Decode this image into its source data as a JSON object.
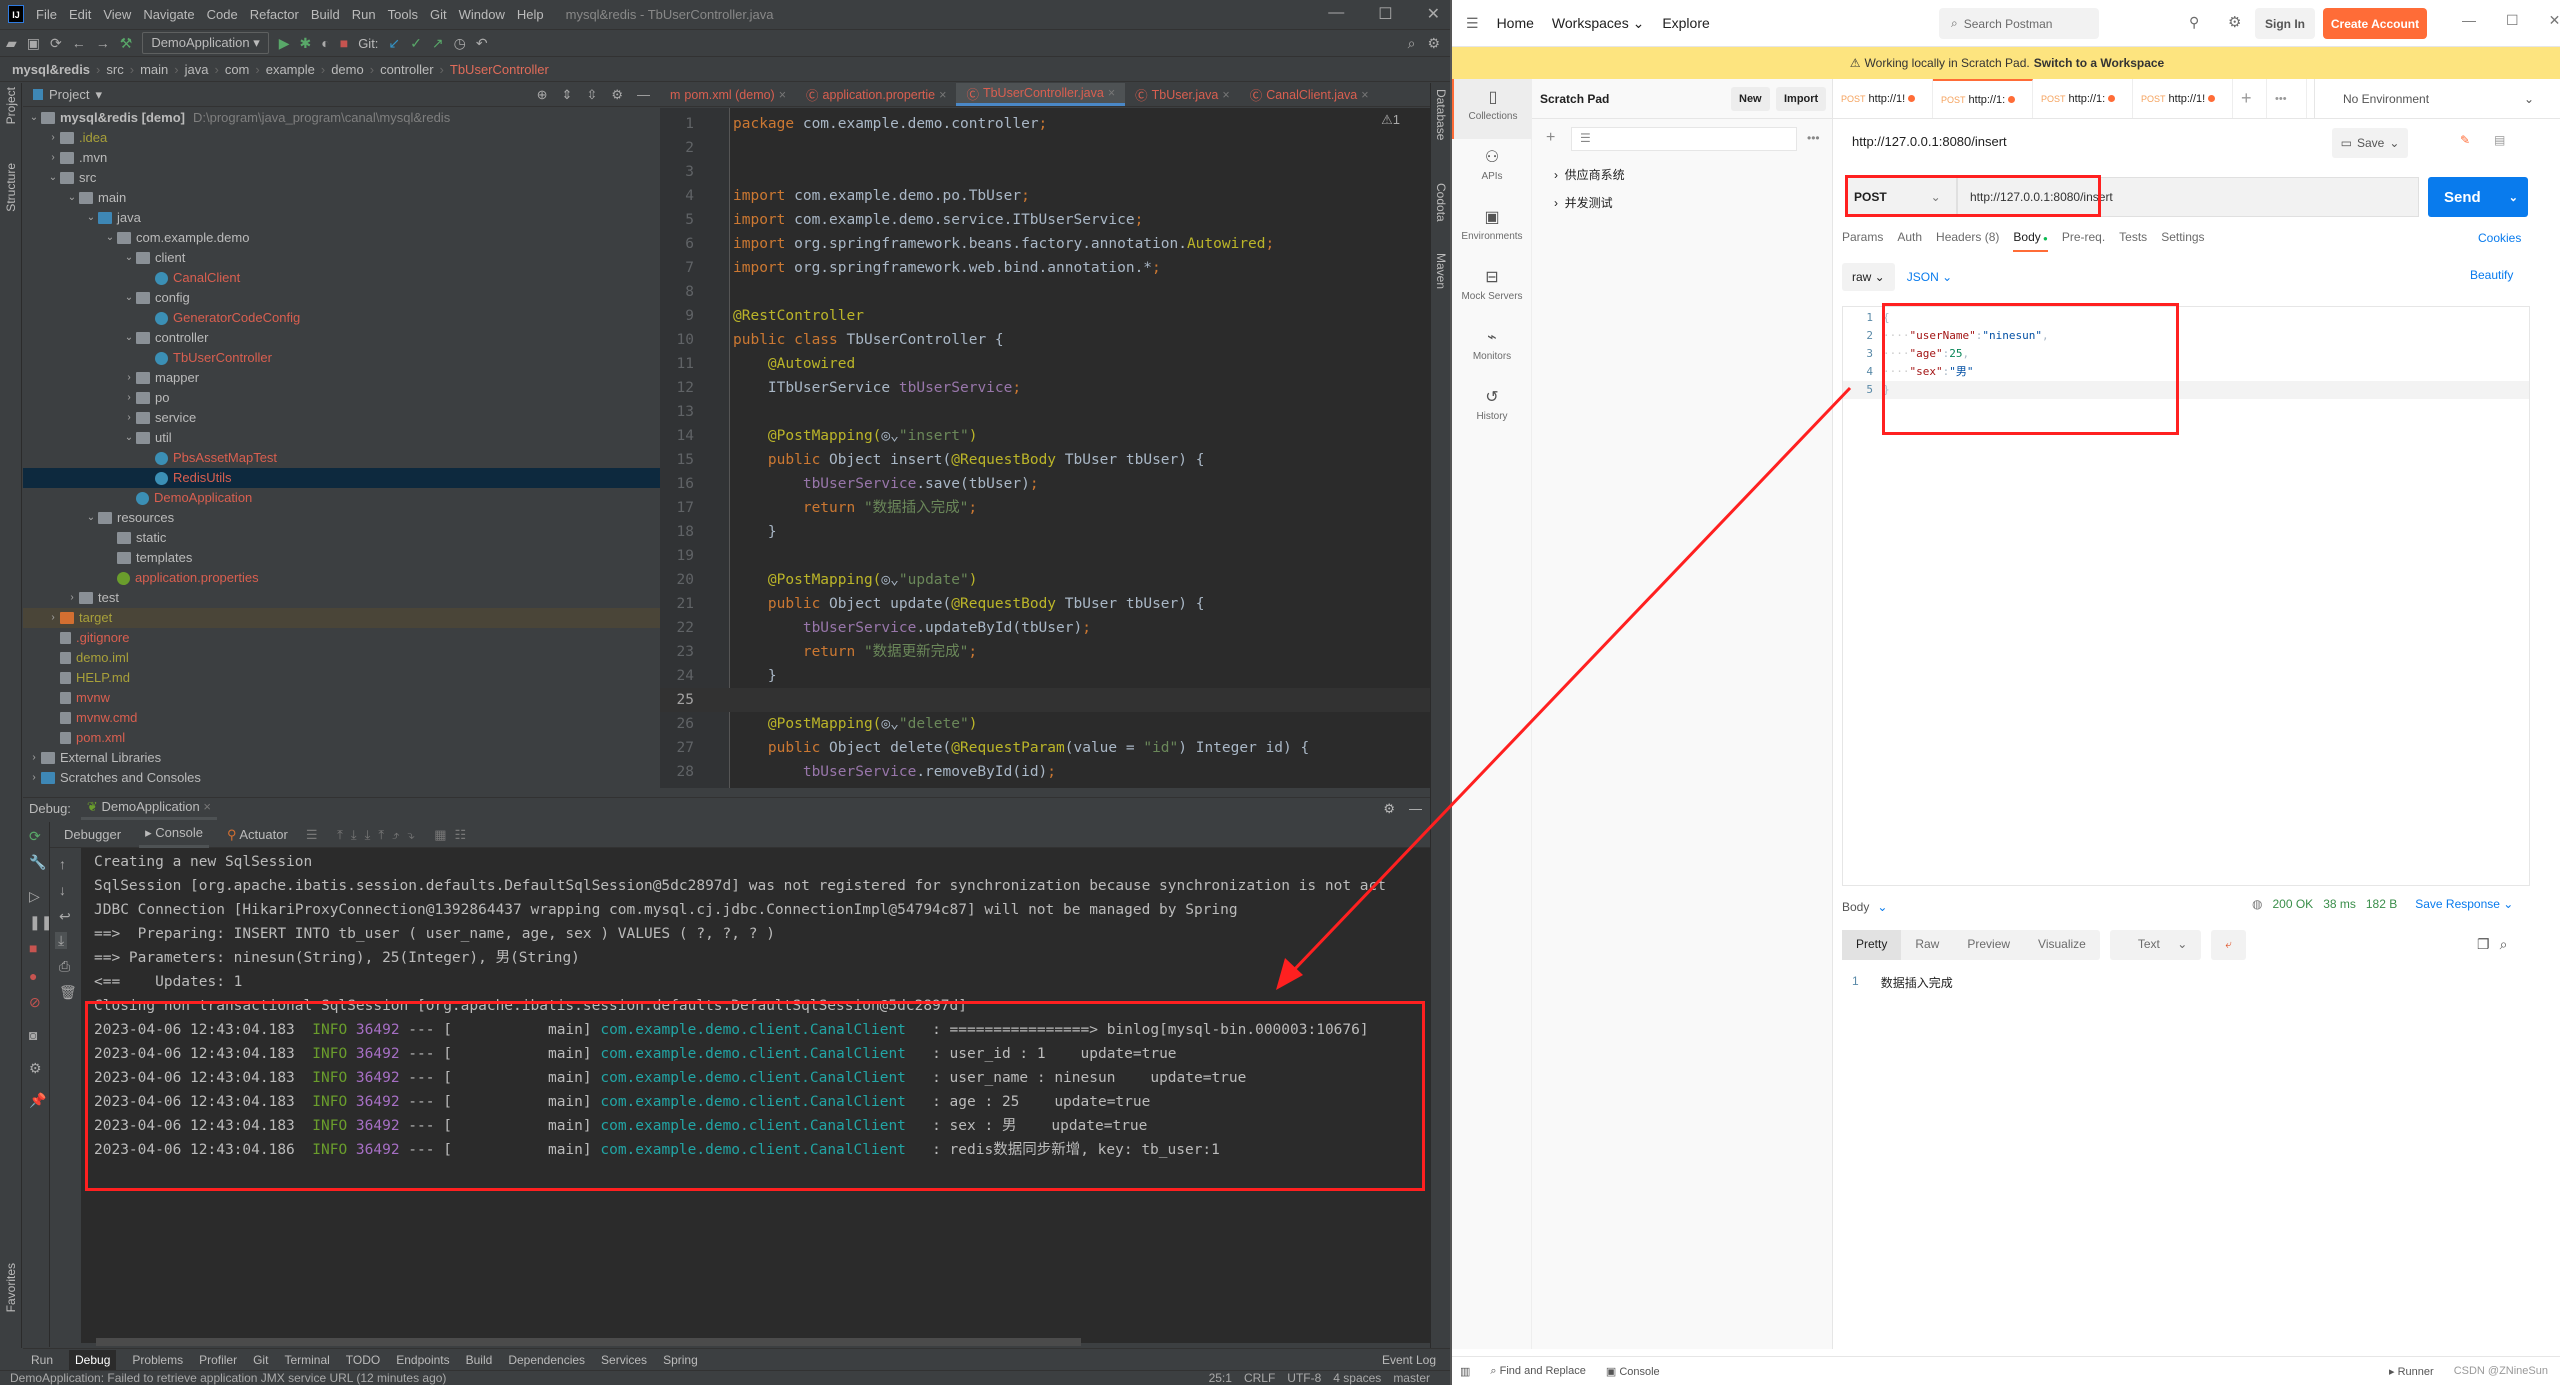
{
  "ide": {
    "logo": "IJ",
    "menu": [
      "File",
      "Edit",
      "View",
      "Navigate",
      "Code",
      "Refactor",
      "Build",
      "Run",
      "Tools",
      "Git",
      "Window",
      "Help"
    ],
    "window_title": "mysql&redis - TbUserController.java",
    "run_config": "DemoApplication",
    "git_label": "Git:",
    "breadcrumb": [
      "mysql&redis",
      "src",
      "main",
      "java",
      "com",
      "example",
      "demo",
      "controller",
      "TbUserController"
    ],
    "project_label": "Project",
    "left_strip": [
      "Project",
      "Structure",
      "Favorites"
    ],
    "right_strip": [
      "Database",
      "Codota",
      "Maven"
    ],
    "tree": [
      {
        "d": 0,
        "o": "v",
        "i": "module",
        "t": "mysql&redis [demo]",
        "c": "gray",
        "s": "D:\\program\\java_program\\canal\\mysql&redis"
      },
      {
        "d": 1,
        "o": ">",
        "i": "folder",
        "t": ".idea",
        "c": "olive"
      },
      {
        "d": 1,
        "o": ">",
        "i": "folder",
        "t": ".mvn",
        "c": "gray"
      },
      {
        "d": 1,
        "o": "v",
        "i": "folder",
        "t": "src",
        "c": "gray"
      },
      {
        "d": 2,
        "o": "v",
        "i": "folder",
        "t": "main",
        "c": "gray"
      },
      {
        "d": 3,
        "o": "v",
        "i": "src",
        "t": "java",
        "c": "gray"
      },
      {
        "d": 4,
        "o": "v",
        "i": "folder",
        "t": "com.example.demo",
        "c": "gray"
      },
      {
        "d": 5,
        "o": "v",
        "i": "folder",
        "t": "client",
        "c": "gray"
      },
      {
        "d": 6,
        "o": "",
        "i": "class",
        "t": "CanalClient",
        "c": "red"
      },
      {
        "d": 5,
        "o": "v",
        "i": "folder",
        "t": "config",
        "c": "gray"
      },
      {
        "d": 6,
        "o": "",
        "i": "class",
        "t": "GeneratorCodeConfig",
        "c": "red"
      },
      {
        "d": 5,
        "o": "v",
        "i": "folder",
        "t": "controller",
        "c": "gray"
      },
      {
        "d": 6,
        "o": "",
        "i": "class",
        "t": "TbUserController",
        "c": "red"
      },
      {
        "d": 5,
        "o": ">",
        "i": "folder",
        "t": "mapper",
        "c": "gray"
      },
      {
        "d": 5,
        "o": ">",
        "i": "folder",
        "t": "po",
        "c": "gray"
      },
      {
        "d": 5,
        "o": ">",
        "i": "folder",
        "t": "service",
        "c": "gray"
      },
      {
        "d": 5,
        "o": "v",
        "i": "folder",
        "t": "util",
        "c": "gray"
      },
      {
        "d": 6,
        "o": "",
        "i": "class",
        "t": "PbsAssetMapTest",
        "c": "red"
      },
      {
        "d": 6,
        "o": "",
        "i": "class",
        "t": "RedisUtils",
        "c": "red",
        "sel": true
      },
      {
        "d": 5,
        "o": "",
        "i": "class",
        "t": "DemoApplication",
        "c": "red"
      },
      {
        "d": 3,
        "o": "v",
        "i": "folder",
        "t": "resources",
        "c": "gray"
      },
      {
        "d": 4,
        "o": "",
        "i": "folder",
        "t": "static",
        "c": "gray"
      },
      {
        "d": 4,
        "o": "",
        "i": "folder",
        "t": "templates",
        "c": "gray"
      },
      {
        "d": 4,
        "o": "",
        "i": "spring",
        "t": "application.properties",
        "c": "red"
      },
      {
        "d": 2,
        "o": ">",
        "i": "folder",
        "t": "test",
        "c": "gray"
      },
      {
        "d": 1,
        "o": ">",
        "i": "orange",
        "t": "target",
        "c": "olive",
        "tgt": true
      },
      {
        "d": 1,
        "o": "",
        "i": "file",
        "t": ".gitignore",
        "c": "red"
      },
      {
        "d": 1,
        "o": "",
        "i": "file",
        "t": "demo.iml",
        "c": "olive"
      },
      {
        "d": 1,
        "o": "",
        "i": "file",
        "t": "HELP.md",
        "c": "olive"
      },
      {
        "d": 1,
        "o": "",
        "i": "file",
        "t": "mvnw",
        "c": "red"
      },
      {
        "d": 1,
        "o": "",
        "i": "file",
        "t": "mvnw.cmd",
        "c": "red"
      },
      {
        "d": 1,
        "o": "",
        "i": "file",
        "t": "pom.xml",
        "c": "red"
      },
      {
        "d": 0,
        "o": ">",
        "i": "lib",
        "t": "External Libraries",
        "c": "gray"
      },
      {
        "d": 0,
        "o": ">",
        "i": "scratch",
        "t": "Scratches and Consoles",
        "c": "gray"
      }
    ],
    "editor_tabs": [
      {
        "t": "pom.xml (demo)"
      },
      {
        "t": "application.propertie"
      },
      {
        "t": "TbUserController.java",
        "active": true
      },
      {
        "t": "TbUser.java"
      },
      {
        "t": "CanalClient.java"
      }
    ],
    "warning_count": "⚠1",
    "code": [
      [
        [
          "package ",
          "kw"
        ],
        [
          "com.example.demo.controller",
          "df"
        ],
        [
          ";",
          "kw"
        ]
      ],
      [],
      [],
      [
        [
          "import ",
          "kw"
        ],
        [
          "com.example.demo.po.TbUser",
          "df"
        ],
        [
          ";",
          "kw"
        ]
      ],
      [
        [
          "import ",
          "kw"
        ],
        [
          "com.example.demo.service.ITbUserService",
          "df"
        ],
        [
          ";",
          "kw"
        ]
      ],
      [
        [
          "import ",
          "kw"
        ],
        [
          "org.springframework.beans.factory.annotation.",
          "df"
        ],
        [
          "Autowired",
          "an"
        ],
        [
          ";",
          "kw"
        ]
      ],
      [
        [
          "import ",
          "kw"
        ],
        [
          "org.springframework.web.bind.annotation.*",
          "df"
        ],
        [
          ";",
          "kw"
        ]
      ],
      [],
      [
        [
          "@RestController",
          "an"
        ]
      ],
      [
        [
          "public class ",
          "kw"
        ],
        [
          "TbUserController {",
          "df"
        ]
      ],
      [
        [
          "    ",
          "df"
        ],
        [
          "@Autowired",
          "an"
        ]
      ],
      [
        [
          "    ITbUserService ",
          "df"
        ],
        [
          "tbUserService",
          "fd"
        ],
        [
          ";",
          "kw"
        ]
      ],
      [],
      [
        [
          "    @PostMapping(",
          "an"
        ],
        [
          "◎⌄",
          "df"
        ],
        [
          "\"insert\"",
          "st"
        ],
        [
          ")",
          "an"
        ]
      ],
      [
        [
          "    public ",
          "kw"
        ],
        [
          "Object ",
          "df"
        ],
        [
          "insert",
          "df"
        ],
        [
          "(",
          "df"
        ],
        [
          "@RequestBody ",
          "an"
        ],
        [
          "TbUser tbUser) {",
          "df"
        ]
      ],
      [
        [
          "        tbUserService",
          "fd"
        ],
        [
          ".save(tbUser)",
          "df"
        ],
        [
          ";",
          "kw"
        ]
      ],
      [
        [
          "        return ",
          "kw"
        ],
        [
          "\"数据插入完成\"",
          "st"
        ],
        [
          ";",
          "kw"
        ]
      ],
      [
        [
          "    }",
          "df"
        ]
      ],
      [],
      [
        [
          "    @PostMapping(",
          "an"
        ],
        [
          "◎⌄",
          "df"
        ],
        [
          "\"update\"",
          "st"
        ],
        [
          ")",
          "an"
        ]
      ],
      [
        [
          "    public ",
          "kw"
        ],
        [
          "Object ",
          "df"
        ],
        [
          "update",
          "df"
        ],
        [
          "(",
          "df"
        ],
        [
          "@RequestBody ",
          "an"
        ],
        [
          "TbUser tbUser) {",
          "df"
        ]
      ],
      [
        [
          "        tbUserService",
          "fd"
        ],
        [
          ".updateById(tbUser)",
          "df"
        ],
        [
          ";",
          "kw"
        ]
      ],
      [
        [
          "        return ",
          "kw"
        ],
        [
          "\"数据更新完成\"",
          "st"
        ],
        [
          ";",
          "kw"
        ]
      ],
      [
        [
          "    }",
          "df"
        ]
      ],
      [],
      [
        [
          "    @PostMapping(",
          "an"
        ],
        [
          "◎⌄",
          "df"
        ],
        [
          "\"delete\"",
          "st"
        ],
        [
          ")",
          "an"
        ]
      ],
      [
        [
          "    public ",
          "kw"
        ],
        [
          "Object ",
          "df"
        ],
        [
          "delete",
          "df"
        ],
        [
          "(",
          "df"
        ],
        [
          "@RequestParam",
          "an"
        ],
        [
          "(value = ",
          "df"
        ],
        [
          "\"id\"",
          "st"
        ],
        [
          ") Integer id) {",
          "df"
        ]
      ],
      [
        [
          "        tbUserService",
          "fd"
        ],
        [
          ".removeById(id)",
          "df"
        ],
        [
          ";",
          "kw"
        ]
      ]
    ],
    "current_line": 25,
    "debug": {
      "label": "Debug:",
      "session": "DemoApplication",
      "tabs": [
        "Debugger",
        "Console",
        "Actuator"
      ]
    },
    "console_plain": [
      "Creating a new SqlSession",
      "SqlSession [org.apache.ibatis.session.defaults.DefaultSqlSession@5dc2897d] was not registered for synchronization because synchronization is not act",
      "JDBC Connection [HikariProxyConnection@1392864437 wrapping com.mysql.cj.jdbc.ConnectionImpl@54794c87] will not be managed by Spring",
      "==>  Preparing: INSERT INTO tb_user ( user_name, age, sex ) VALUES ( ?, ?, ? )",
      "==> Parameters: ninesun(String), 25(Integer), 男(String)",
      "<==    Updates: 1",
      "Closing non transactional SqlSession [org.apache.ibatis.session.defaults.DefaultSqlSession@5dc2897d]"
    ],
    "console_log": [
      {
        "ts": "2023-04-06 12:43:04.183",
        "lv": "INFO",
        "pid": "36492",
        "th": "main",
        "lg": "com.example.demo.client.CanalClient",
        "msg": ": ================> binlog[mysql-bin.000003:10676]"
      },
      {
        "ts": "2023-04-06 12:43:04.183",
        "lv": "INFO",
        "pid": "36492",
        "th": "main",
        "lg": "com.example.demo.client.CanalClient",
        "msg": ": user_id : 1    update=true"
      },
      {
        "ts": "2023-04-06 12:43:04.183",
        "lv": "INFO",
        "pid": "36492",
        "th": "main",
        "lg": "com.example.demo.client.CanalClient",
        "msg": ": user_name : ninesun    update=true"
      },
      {
        "ts": "2023-04-06 12:43:04.183",
        "lv": "INFO",
        "pid": "36492",
        "th": "main",
        "lg": "com.example.demo.client.CanalClient",
        "msg": ": age : 25    update=true"
      },
      {
        "ts": "2023-04-06 12:43:04.183",
        "lv": "INFO",
        "pid": "36492",
        "th": "main",
        "lg": "com.example.demo.client.CanalClient",
        "msg": ": sex : 男    update=true"
      },
      {
        "ts": "2023-04-06 12:43:04.186",
        "lv": "INFO",
        "pid": "36492",
        "th": "main",
        "lg": "com.example.demo.client.CanalClient",
        "msg": ": redis数据同步新增, key: tb_user:1"
      }
    ],
    "tool_windows": [
      "Run",
      "Debug",
      "Problems",
      "Profiler",
      "Git",
      "Terminal",
      "TODO",
      "Endpoints",
      "Build",
      "Dependencies",
      "Services",
      "Spring"
    ],
    "event_log": "Event Log",
    "status_msg": "DemoApplication: Failed to retrieve application JMX service URL (12 minutes ago)",
    "status_right": [
      "25:1",
      "CRLF",
      "UTF-8",
      "4 spaces",
      "master"
    ]
  },
  "postman": {
    "nav": [
      "Home",
      "Workspaces ⌄",
      "Explore"
    ],
    "search_placeholder": "Search Postman",
    "sign_in": "Sign In",
    "create_account": "Create Account",
    "banner_text": "Working locally in Scratch Pad.",
    "banner_link": "Switch to a Workspace",
    "sidebar": [
      {
        "icon": "collections-icon",
        "g": "▯",
        "label": "Collections",
        "active": true
      },
      {
        "icon": "apis-icon",
        "g": "⚇",
        "label": "APIs"
      },
      {
        "icon": "environments-icon",
        "g": "▣",
        "label": "Environments"
      },
      {
        "icon": "mock-servers-icon",
        "g": "⊟",
        "label": "Mock Servers"
      },
      {
        "icon": "monitors-icon",
        "g": "⌁",
        "label": "Monitors"
      },
      {
        "icon": "history-icon",
        "g": "↺",
        "label": "History"
      }
    ],
    "scratch_title": "Scratch Pad",
    "new_label": "New",
    "import_label": "Import",
    "collections": [
      "供应商系统",
      "并发测试"
    ],
    "tabs": [
      {
        "m": "POST",
        "u": "http://1!"
      },
      {
        "m": "POST",
        "u": "http://1:",
        "active": true
      },
      {
        "m": "POST",
        "u": "http://1:"
      },
      {
        "m": "POST",
        "u": "http://1!"
      }
    ],
    "environment": "No Environment",
    "request_title": "http://127.0.0.1:8080/insert",
    "save_label": "Save",
    "method": "POST",
    "url": "http://127.0.0.1:8080/insert",
    "send_label": "Send",
    "param_tabs": [
      "Params",
      "Auth",
      "Headers (8)",
      "Body",
      "Pre-req.",
      "Tests",
      "Settings"
    ],
    "active_param_tab": "Body",
    "cookies": "Cookies",
    "body_mode": "raw",
    "body_lang": "JSON",
    "beautify": "Beautify",
    "body_lines": [
      [
        [
          "{",
          "df"
        ]
      ],
      [
        [
          "····",
          "dim"
        ],
        [
          "\"userName\"",
          "jk"
        ],
        [
          ":",
          "df"
        ],
        [
          "\"ninesun\"",
          "js"
        ],
        [
          ",",
          "df"
        ]
      ],
      [
        [
          "····",
          "dim"
        ],
        [
          "\"age\"",
          "jk"
        ],
        [
          ":",
          "df"
        ],
        [
          "25",
          "jn"
        ],
        [
          ",",
          "df"
        ]
      ],
      [
        [
          "····",
          "dim"
        ],
        [
          "\"sex\"",
          "jk"
        ],
        [
          ":",
          "df"
        ],
        [
          "\"男\"",
          "js"
        ]
      ],
      [
        [
          "}",
          "df"
        ]
      ]
    ],
    "response": {
      "label": "Body",
      "status": "200 OK",
      "time": "38 ms",
      "size": "182 B",
      "save": "Save Response",
      "views": [
        "Pretty",
        "Raw",
        "Preview",
        "Visualize"
      ],
      "format": "Text",
      "lines": [
        "数据插入完成"
      ]
    },
    "footer": [
      "Find and Replace",
      "Console"
    ],
    "footer_right": "Runner",
    "watermark": "CSDN @ZNineSun"
  },
  "colors": {
    "annotation": "#ff2020",
    "postman_orange": "#ff6c37",
    "send_blue": "#097bed",
    "ide_bg": "#2b2b2b"
  }
}
